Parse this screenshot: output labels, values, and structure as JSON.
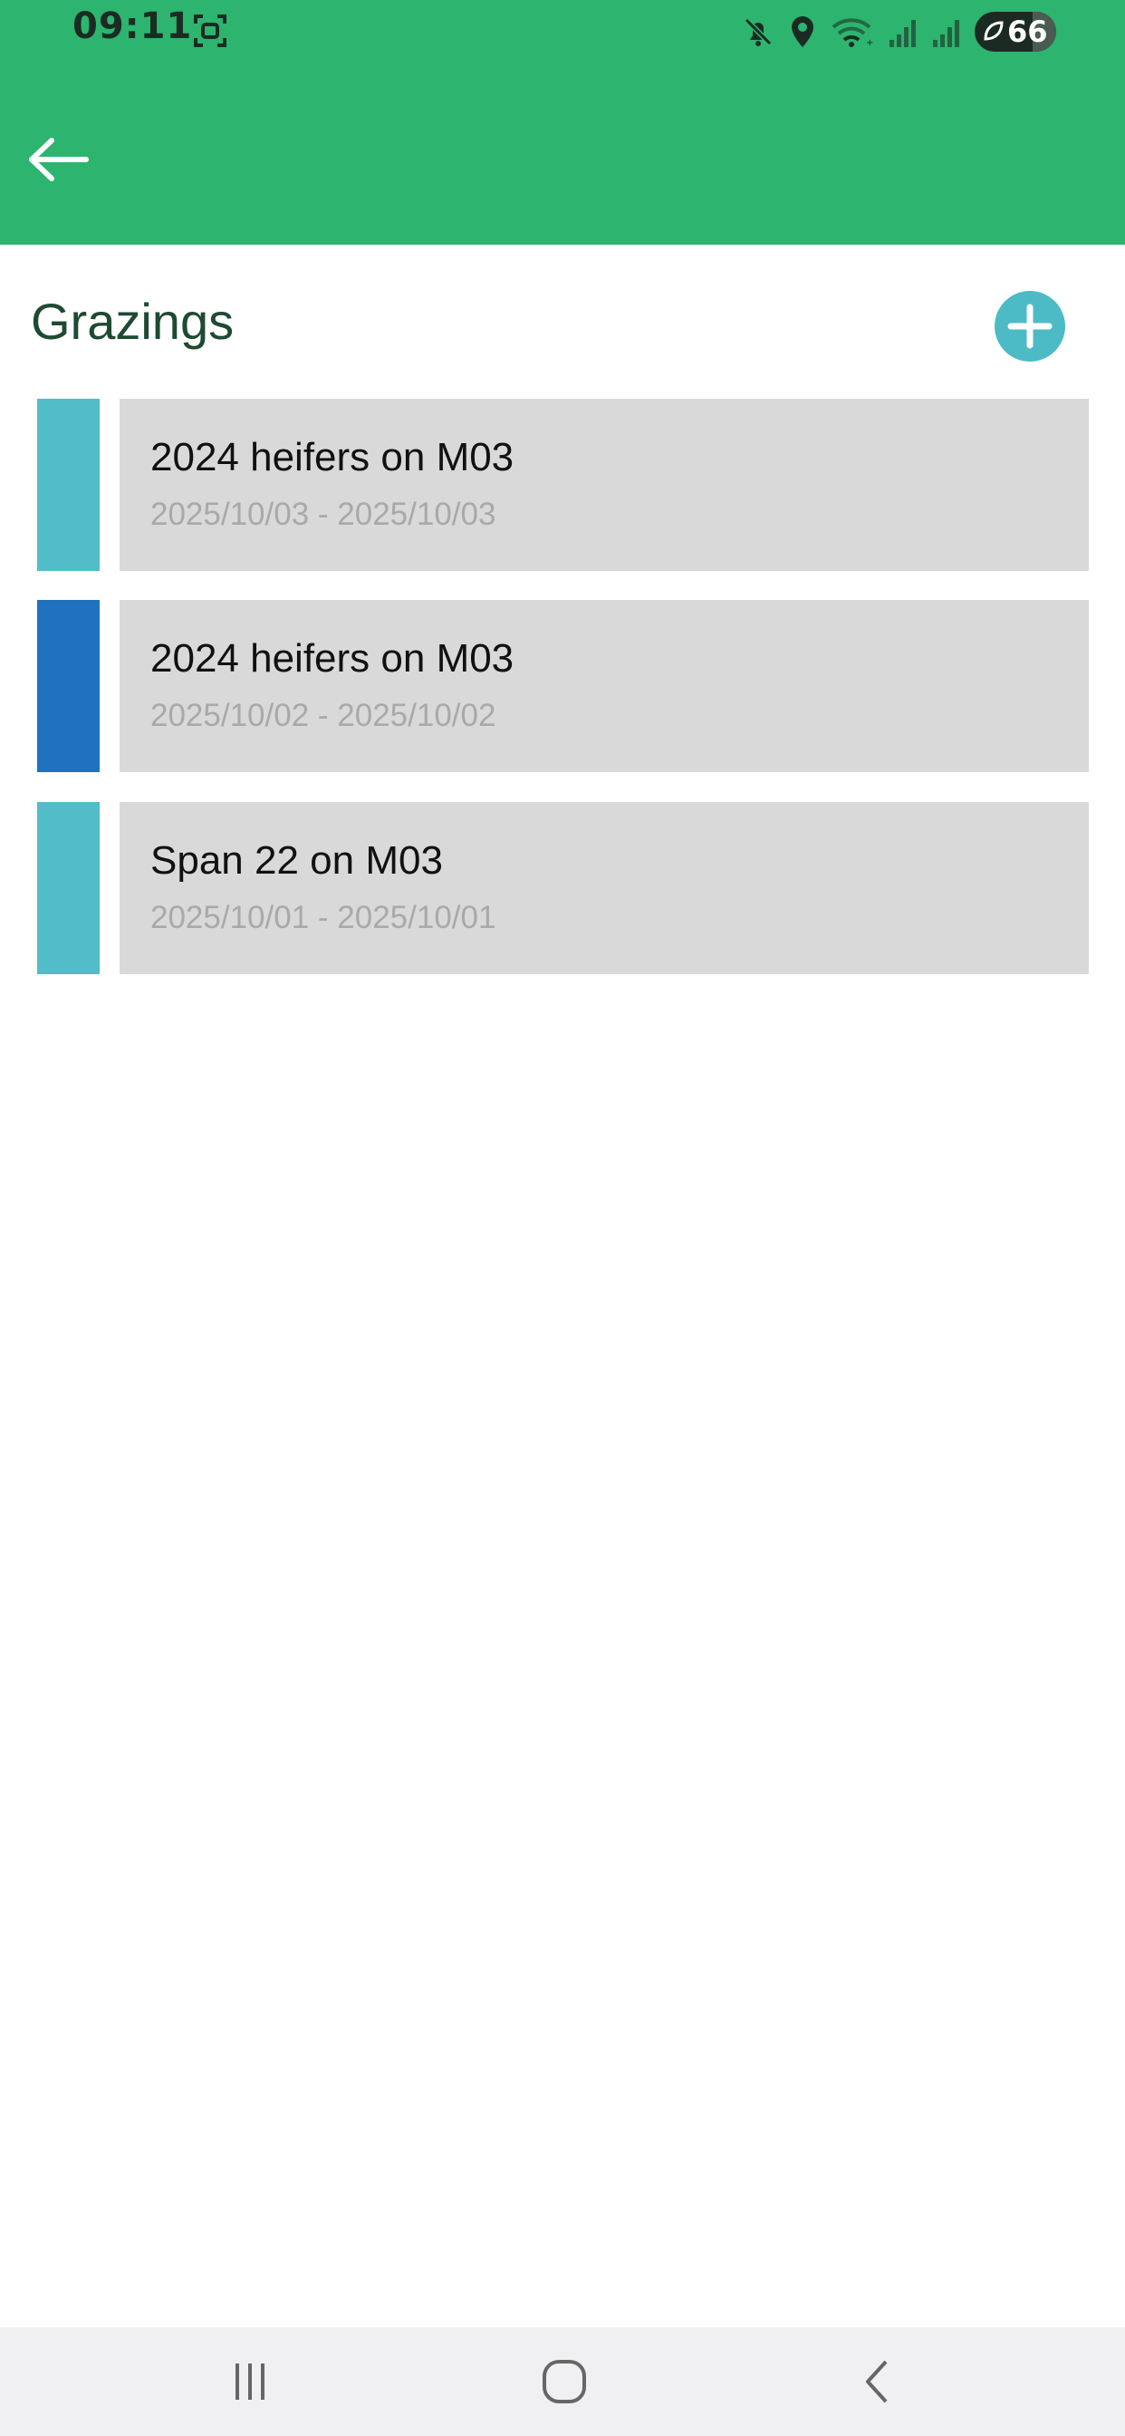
{
  "status_bar": {
    "time": "09:11",
    "battery_level": "66",
    "icons": [
      "screenshot-icon",
      "mute-icon",
      "location-icon",
      "wifi-icon",
      "signal-icon",
      "signal-icon",
      "battery-saver-icon"
    ]
  },
  "app_bar": {
    "back_icon": "arrow-left-icon",
    "background_color": "#2db46f"
  },
  "section": {
    "title": "Grazings",
    "add_icon": "plus-circle-icon",
    "add_color": "#4dbbc6"
  },
  "grazings": [
    {
      "title": "2024 heifers on M03",
      "dates": "2025/10/03 - 2025/10/03",
      "color": "#52bcc9"
    },
    {
      "title": "2024 heifers on M03",
      "dates": "2025/10/02 - 2025/10/02",
      "color": "#1f72bd"
    },
    {
      "title": "Span 22 on M03",
      "dates": "2025/10/01 - 2025/10/01",
      "color": "#52bcc9"
    }
  ],
  "nav_bar": {
    "icons": [
      "recent-apps-icon",
      "home-icon",
      "back-icon"
    ]
  }
}
